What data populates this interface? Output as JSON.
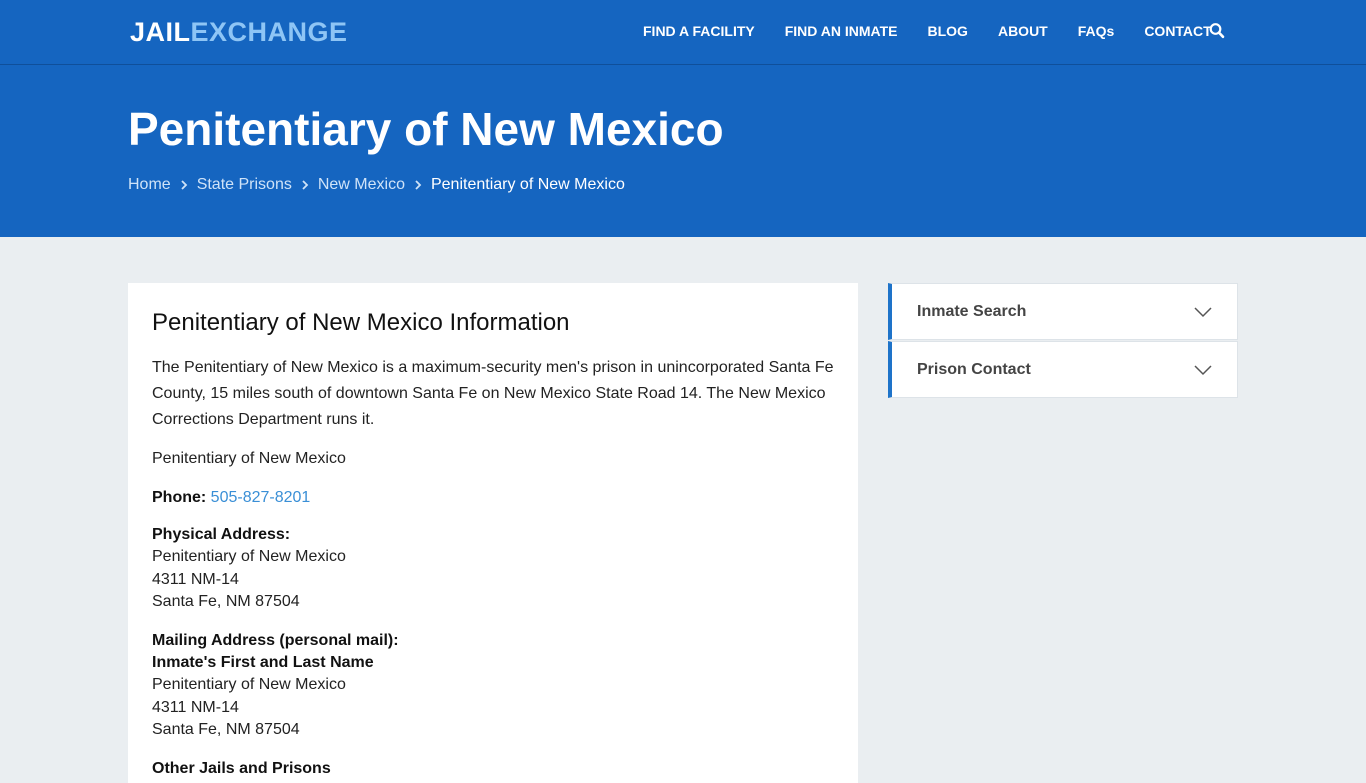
{
  "brand": {
    "part1": "JAIL",
    "part2": "EXCHANGE"
  },
  "nav": {
    "items": [
      {
        "label": "FIND A FACILITY"
      },
      {
        "label": "FIND AN INMATE"
      },
      {
        "label": "BLOG"
      },
      {
        "label": "ABOUT"
      },
      {
        "label": "FAQs"
      },
      {
        "label": "CONTACT"
      }
    ],
    "search_icon": "search-icon"
  },
  "hero": {
    "title": "Penitentiary of New Mexico",
    "breadcrumbs": [
      {
        "label": "Home"
      },
      {
        "label": "State Prisons"
      },
      {
        "label": "New Mexico"
      },
      {
        "label": "Penitentiary of New Mexico"
      }
    ]
  },
  "main": {
    "heading": "Penitentiary of New Mexico Information",
    "intro": "The Penitentiary of New Mexico is a maximum-security men's prison in unincorporated Santa Fe County, 15 miles south of downtown Santa Fe on New Mexico State Road 14. The New Mexico Corrections Department runs it.",
    "facility_name": "Penitentiary of New Mexico",
    "phone_label": "Phone:",
    "phone": "505-827-8201",
    "physical_label": "Physical Address:",
    "physical": [
      "Penitentiary of New Mexico",
      "4311 NM-14",
      "Santa Fe, NM 87504"
    ],
    "mailing_label": "Mailing Address (personal mail):",
    "mailing_name": "Inmate's First and Last Name",
    "mailing": [
      "Penitentiary of New Mexico",
      "4311 NM-14",
      "Santa Fe, NM 87504"
    ],
    "other_label": "Other Jails and Prisons"
  },
  "sidebar": {
    "items": [
      {
        "label": "Inmate Search"
      },
      {
        "label": "Prison Contact"
      }
    ]
  },
  "colors": {
    "nav_bg": "#1565c0",
    "accent": "#1e73c9",
    "link": "#3a8fd6",
    "page_bg": "#eaeef1"
  }
}
